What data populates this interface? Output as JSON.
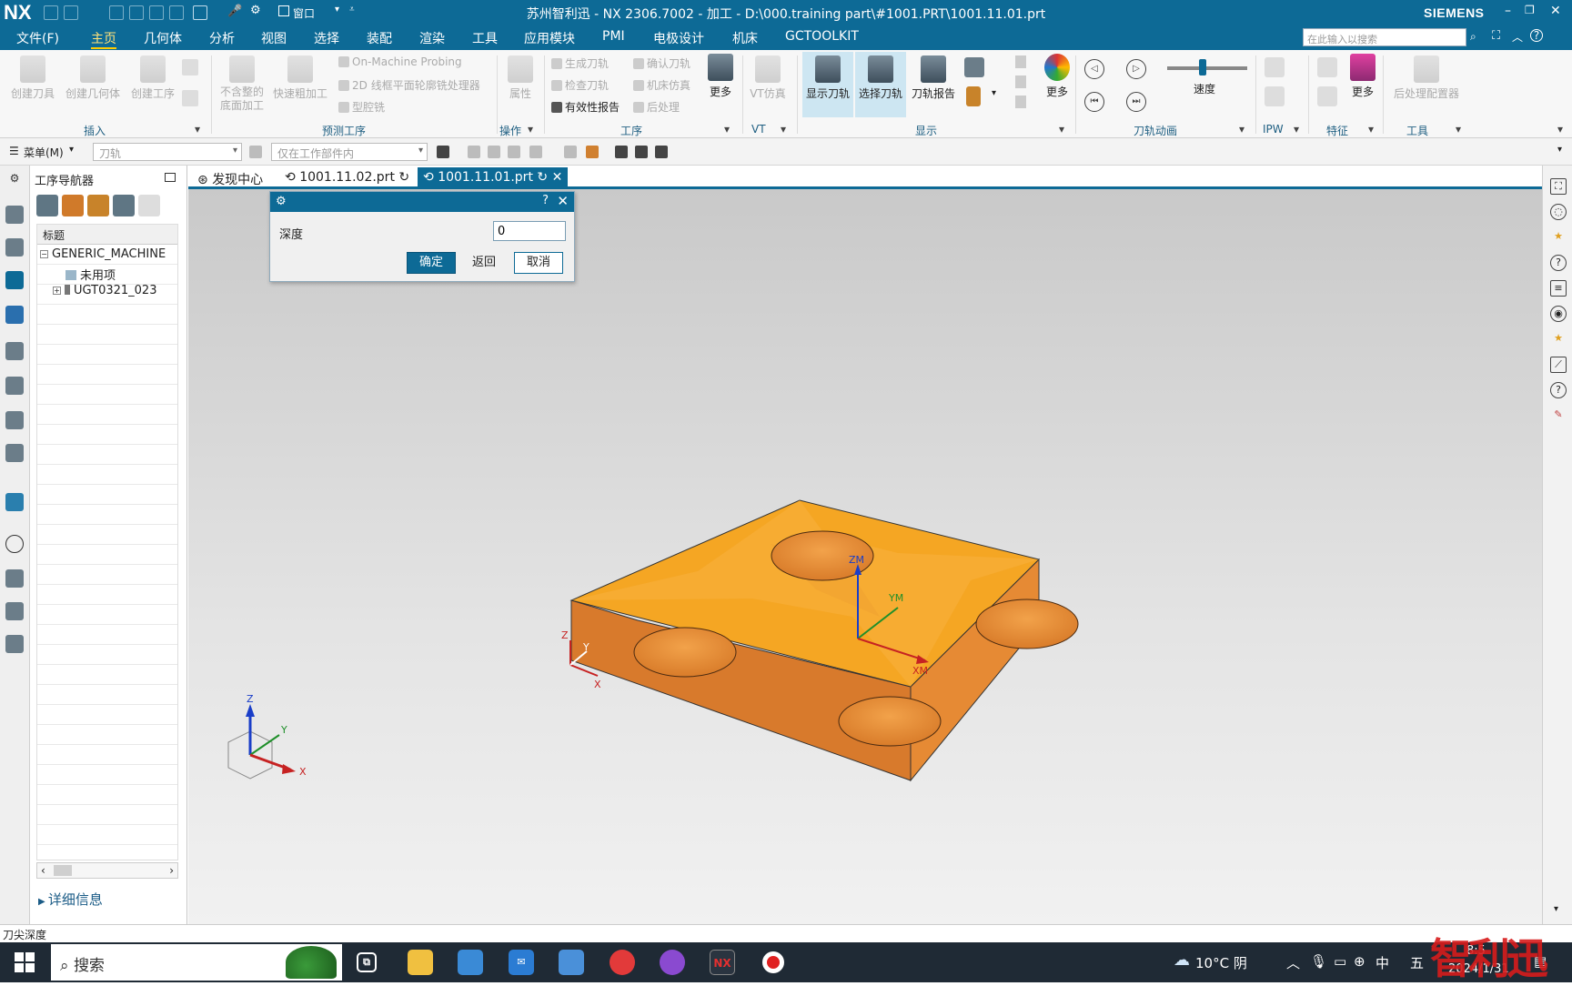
{
  "titlebar": {
    "logo": "NX",
    "window_menu": "窗口",
    "title": "苏州智利迅 - NX 2306.7002 - 加工 - D:\\000.training part\\#1001.PRT\\1001.11.01.prt",
    "brand": "SIEMENS",
    "minimize": "–",
    "restore": "❐",
    "close": "✕"
  },
  "menubar": {
    "file": "文件(F)",
    "tabs": [
      "主页",
      "几何体",
      "分析",
      "视图",
      "选择",
      "装配",
      "渲染",
      "工具",
      "应用模块",
      "PMI",
      "电极设计",
      "机床",
      "GCTOOLKIT"
    ],
    "search_placeholder": "在此输入以搜索"
  },
  "ribbon": {
    "insert": {
      "buttons": [
        "创建刀具",
        "创建几何体",
        "创建工序"
      ],
      "group": "插入"
    },
    "predict": {
      "buttons": [
        "不含整的\n底面加工",
        "快速粗加工"
      ],
      "small": [
        "On-Machine Probing",
        "2D 线框平面轮廓铣处理器",
        "型腔铣"
      ],
      "group": "预测工序"
    },
    "operation": {
      "attr": "属性",
      "group": "操作"
    },
    "procedure": {
      "small": [
        "生成刀轨",
        "确认刀轨",
        "检查刀轨",
        "机床仿真",
        "有效性报告",
        "后处理"
      ],
      "more": "更多",
      "group": "工序"
    },
    "vt": {
      "label": "VT仿真",
      "group": "VT"
    },
    "display": {
      "buttons": [
        "显示刀轨",
        "选择刀轨",
        "刀轨报告"
      ],
      "more": "更多",
      "group": "显示"
    },
    "animation": {
      "speed": "速度",
      "group": "刀轨动画"
    },
    "ipw": {
      "group": "IPW"
    },
    "feature": {
      "more": "更多",
      "group": "特征"
    },
    "tools": {
      "post": "后处理配置器",
      "group": "工具"
    }
  },
  "filterbar": {
    "menu": "菜单(M)",
    "type_filter": "刀轨",
    "scope_filter": "仅在工作部件内"
  },
  "navigator": {
    "title": "工序导航器",
    "column": "标题",
    "root": "GENERIC_MACHINE",
    "unused": "未用项",
    "item": "UGT0321_023",
    "details": "详细信息"
  },
  "doc_tabs": [
    "发现中心",
    "1001.11.02.prt",
    "1001.11.01.prt"
  ],
  "dialog": {
    "label": "深度",
    "value": "0",
    "ok": "确定",
    "back": "返回",
    "cancel": "取消"
  },
  "viewport": {
    "wcs_labels": {
      "z": "ZM",
      "y": "YM",
      "x": "XM"
    },
    "csys_labels": {
      "z": "Z",
      "y": "Y",
      "x": "X"
    },
    "triad_labels": {
      "z": "Z",
      "y": "Y",
      "x": "X"
    },
    "part_color": "#f5a623"
  },
  "statusbar": {
    "text": "刀尖深度"
  },
  "taskbar": {
    "search": "搜索",
    "weather": "10°C 阴",
    "ime": "中",
    "time": "8:5",
    "date": "2024/1/31",
    "apps": [
      "file-explorer",
      "store",
      "mail",
      "app-bird",
      "app-red",
      "app-mask",
      "nx",
      "recorder"
    ]
  },
  "watermark": "智利迅"
}
